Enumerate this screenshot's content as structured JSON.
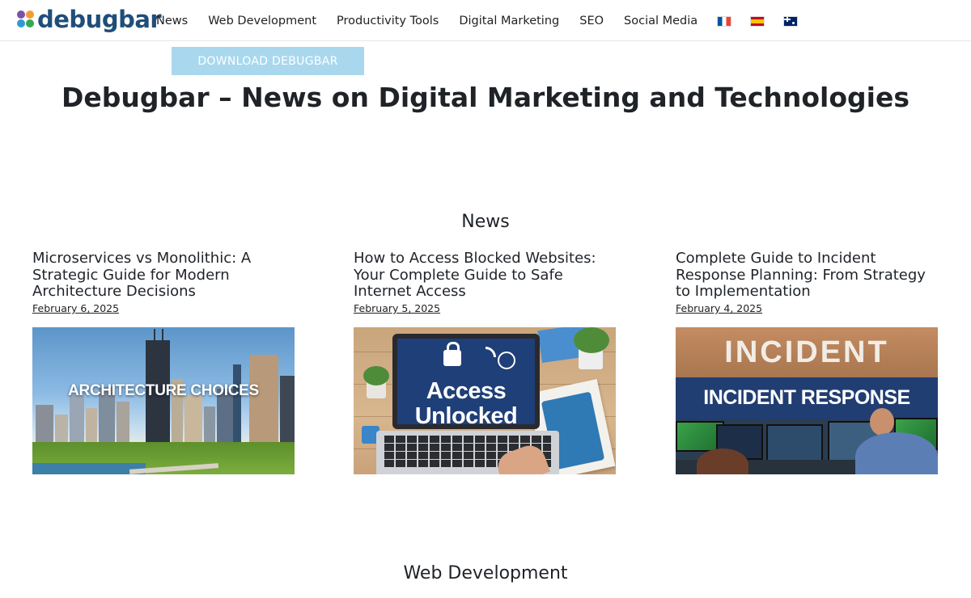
{
  "brand": {
    "name": "debugbar"
  },
  "nav": {
    "items": [
      {
        "label": "News"
      },
      {
        "label": "Web Development"
      },
      {
        "label": "Productivity Tools"
      },
      {
        "label": "Digital Marketing"
      },
      {
        "label": "SEO"
      },
      {
        "label": "Social Media"
      }
    ],
    "flags": [
      "flag-fr-icon",
      "flag-es-icon",
      "flag-au-icon"
    ]
  },
  "download_button": {
    "label": "DOWNLOAD DEBUGBAR",
    "color": "#a9d8ee"
  },
  "page_title": "Debugbar – News on Digital Marketing and Technologies",
  "sections": {
    "news": {
      "heading": "News",
      "articles": [
        {
          "title": "Microservices vs Monolithic: A Strategic Guide for Modern Architecture Decisions",
          "date": "February 6, 2025",
          "image_text": "ARCHITECTURE CHOICES"
        },
        {
          "title": "How to Access Blocked Websites: Your Complete Guide to Safe Internet Access",
          "date": "February 5, 2025",
          "image_text_line1": "Access",
          "image_text_line2": "Unlocked"
        },
        {
          "title": "Complete Guide to Incident Response Planning: From Strategy to Implementation",
          "date": "February 4, 2025",
          "image_text_wall": "INCIDENT",
          "image_text_banner": "INCIDENT RESPONSE"
        }
      ]
    },
    "web_development": {
      "heading": "Web Development"
    }
  }
}
